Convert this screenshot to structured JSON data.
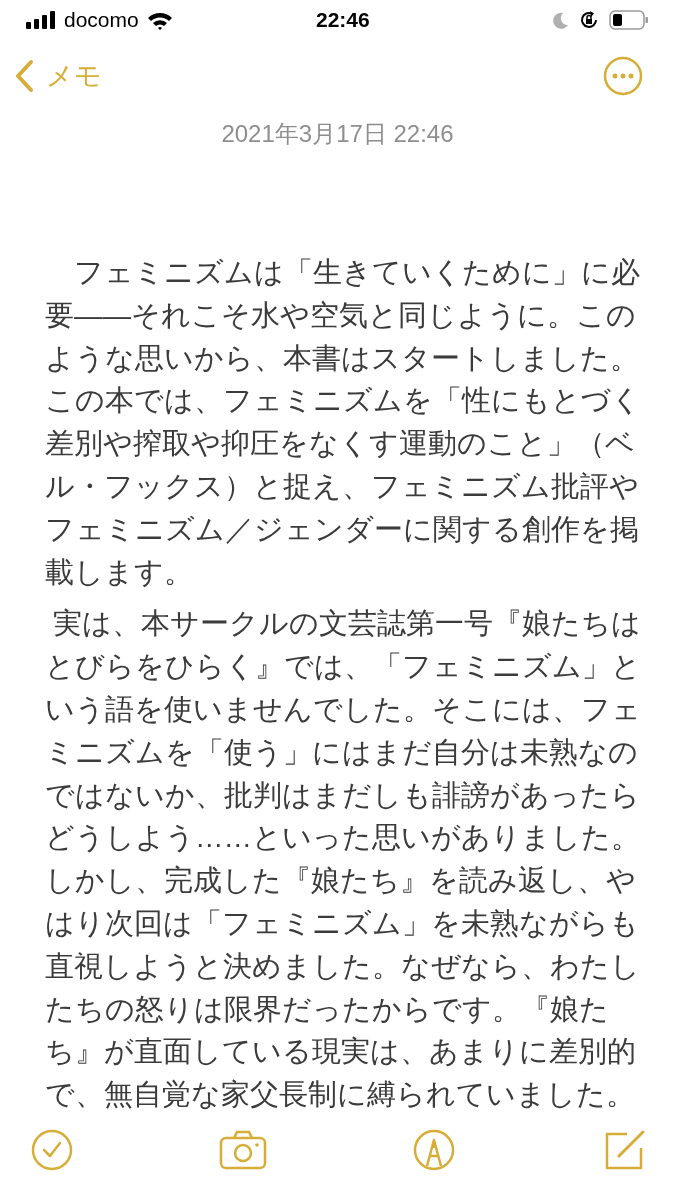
{
  "status_bar": {
    "carrier": "docomo",
    "time": "22:46"
  },
  "nav": {
    "back_label": "メモ"
  },
  "note": {
    "date": "2021年3月17日 22:46",
    "paragraphs": [
      {
        "lines": [
          "　フェミニズムは「生きていくために」に必",
          "要——それこそ水や空気と同じように。この",
          "ような思いから、本書はスタートしました。",
          "この本では、フェミニズムを「性にもとづく",
          "差別や搾取や抑圧をなくす運動のこと」（ベ",
          "ル・フックス）と捉え、フェミニズム批評や",
          "フェミニズム／ジェンダーに関する創作を掲",
          "載します。"
        ]
      },
      {
        "lines": [
          " 実は、本サークルの文芸誌第一号『娘たちは",
          "とびらをひらく』では、「フェミニズム」と",
          "いう語を使いませんでした。そこには、フェ",
          "ミニズムを「使う」にはまだ自分は未熟なの",
          "ではないか、批判はまだしも誹謗があったら",
          "どうしよう……といった思いがありました。",
          "しかし、完成した『娘たち』を読み返し、や",
          "はり次回は「フェミニズム」を未熟ながらも",
          "直視しようと決めました。なぜなら、わたし",
          "たちの怒りは限界だったからです。『娘た",
          "ち』が直面している現実は、あまりに差別的",
          "で、無自覚な家父長制に縛られていました。"
        ]
      }
    ]
  },
  "toolbar": {
    "items": [
      {
        "kind": "checklist"
      },
      {
        "kind": "camera"
      },
      {
        "kind": "markup"
      },
      {
        "kind": "compose"
      }
    ]
  }
}
